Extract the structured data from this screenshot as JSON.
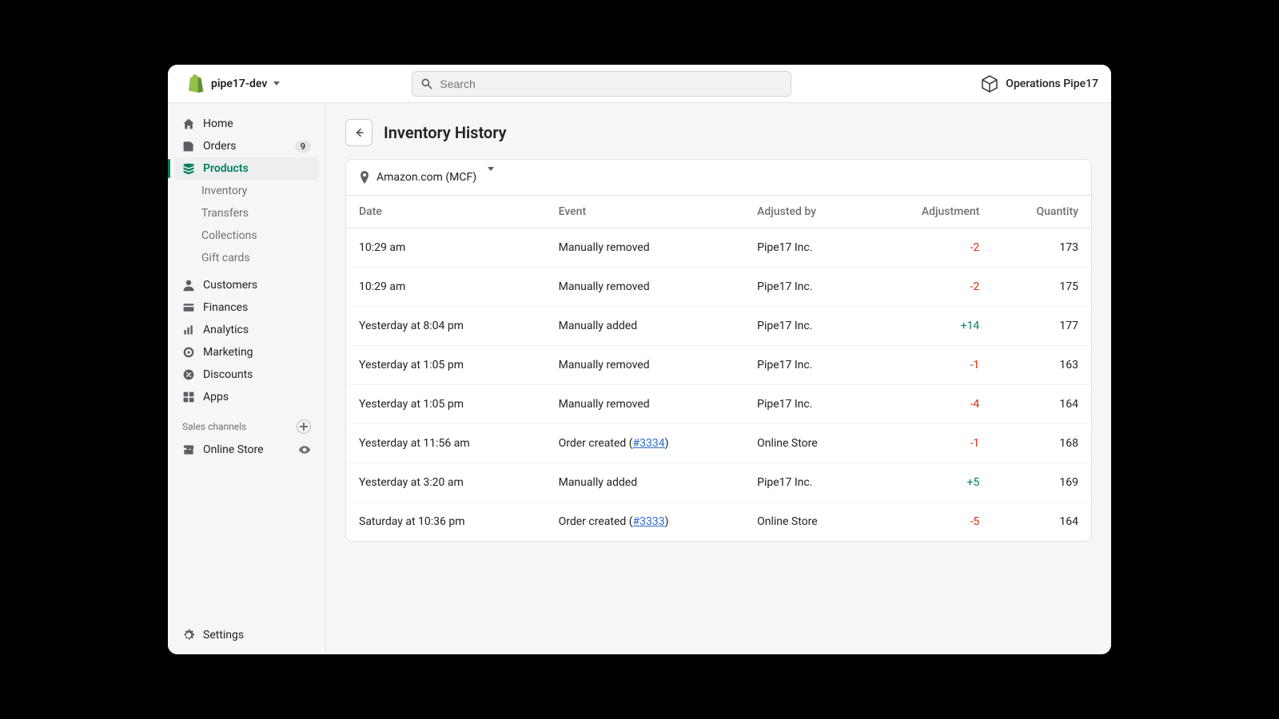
{
  "header": {
    "store_name": "pipe17-dev",
    "search_placeholder": "Search",
    "profile_name": "Operations Pipe17"
  },
  "sidebar": {
    "home": "Home",
    "orders": "Orders",
    "orders_badge": "9",
    "products": "Products",
    "sub": {
      "inventory": "Inventory",
      "transfers": "Transfers",
      "collections": "Collections",
      "gift_cards": "Gift cards"
    },
    "customers": "Customers",
    "finances": "Finances",
    "analytics": "Analytics",
    "marketing": "Marketing",
    "discounts": "Discounts",
    "apps": "Apps",
    "sales_channels": "Sales channels",
    "online_store": "Online Store",
    "settings": "Settings"
  },
  "page": {
    "title": "Inventory History",
    "location": "Amazon.com (MCF)"
  },
  "table": {
    "headers": {
      "date": "Date",
      "event": "Event",
      "adjusted_by": "Adjusted by",
      "adjustment": "Adjustment",
      "quantity": "Quantity"
    },
    "rows": [
      {
        "date": "10:29 am",
        "event": "Manually removed",
        "order": null,
        "adjusted_by": "Pipe17 Inc.",
        "adjustment": "-2",
        "adj_class": "neg",
        "quantity": "173"
      },
      {
        "date": "10:29 am",
        "event": "Manually removed",
        "order": null,
        "adjusted_by": "Pipe17 Inc.",
        "adjustment": "-2",
        "adj_class": "neg",
        "quantity": "175"
      },
      {
        "date": "Yesterday at 8:04 pm",
        "event": "Manually added",
        "order": null,
        "adjusted_by": "Pipe17 Inc.",
        "adjustment": "+14",
        "adj_class": "pos",
        "quantity": "177"
      },
      {
        "date": "Yesterday at 1:05 pm",
        "event": "Manually removed",
        "order": null,
        "adjusted_by": "Pipe17 Inc.",
        "adjustment": "-1",
        "adj_class": "neg",
        "quantity": "163"
      },
      {
        "date": "Yesterday at 1:05 pm",
        "event": "Manually removed",
        "order": null,
        "adjusted_by": "Pipe17 Inc.",
        "adjustment": "-4",
        "adj_class": "neg",
        "quantity": "164"
      },
      {
        "date": "Yesterday at 11:56 am",
        "event": "Order created",
        "order": "#3334",
        "adjusted_by": "Online Store",
        "adjustment": "-1",
        "adj_class": "neg",
        "quantity": "168"
      },
      {
        "date": "Yesterday at 3:20 am",
        "event": "Manually added",
        "order": null,
        "adjusted_by": "Pipe17 Inc.",
        "adjustment": "+5",
        "adj_class": "pos",
        "quantity": "169"
      },
      {
        "date": "Saturday at 10:36 pm",
        "event": "Order created",
        "order": "#3333",
        "adjusted_by": "Online Store",
        "adjustment": "-5",
        "adj_class": "neg",
        "quantity": "164"
      }
    ]
  }
}
